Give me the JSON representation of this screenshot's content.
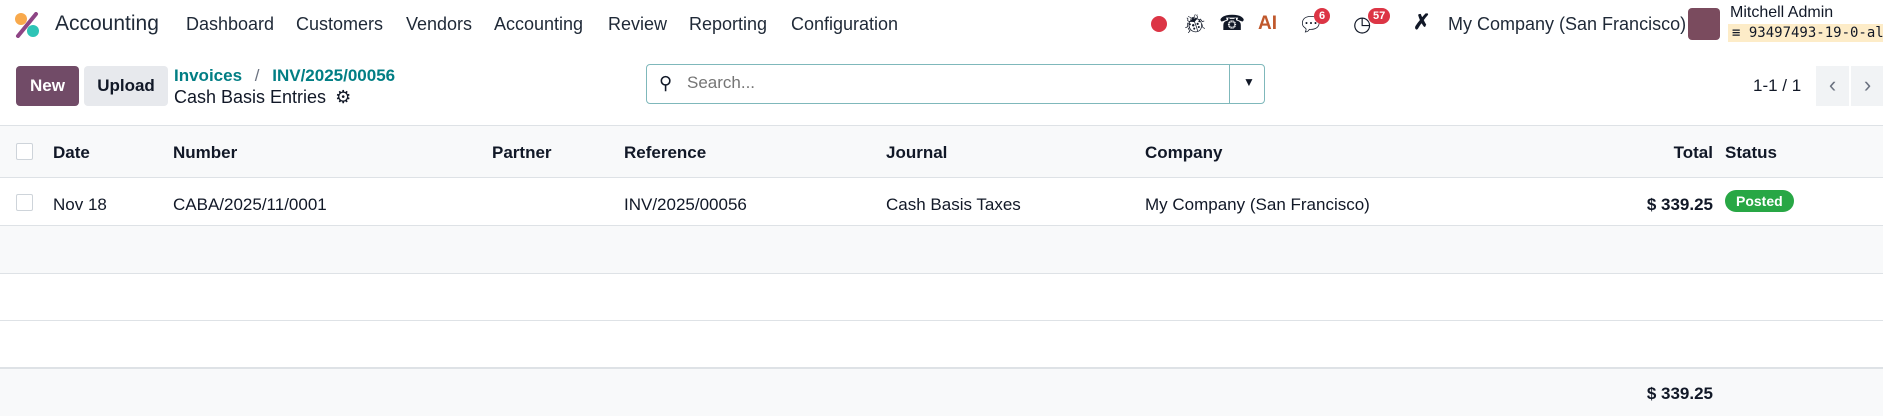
{
  "navbar": {
    "app_name": "Accounting",
    "menu": [
      "Dashboard",
      "Customers",
      "Vendors",
      "Accounting",
      "Review",
      "Reporting",
      "Configuration"
    ],
    "messages_count": "6",
    "activities_count": "57",
    "ai_label": "AI",
    "company": "My Company (San Francisco)",
    "user_name": "Mitchell Admin",
    "database": "93497493-19-0-al"
  },
  "control_panel": {
    "new_label": "New",
    "upload_label": "Upload",
    "breadcrumb": [
      "Invoices",
      "INV/2025/00056"
    ],
    "breadcrumb_sep": "/",
    "title": "Cash Basis Entries",
    "search_placeholder": "Search...",
    "pager": "1-1 / 1"
  },
  "table": {
    "headers": {
      "date": "Date",
      "number": "Number",
      "partner": "Partner",
      "reference": "Reference",
      "journal": "Journal",
      "company": "Company",
      "total": "Total",
      "status": "Status"
    },
    "rows": [
      {
        "date": "Nov 18",
        "number": "CABA/2025/11/0001",
        "partner": "",
        "reference": "INV/2025/00056",
        "journal": "Cash Basis Taxes",
        "company": "My Company (San Francisco)",
        "total": "$ 339.25",
        "status": "Posted"
      }
    ],
    "footer_total": "$ 339.25"
  },
  "colors": {
    "primary": "#714b67",
    "link": "#017e84",
    "posted": "#28a745",
    "badge": "#dc3545"
  }
}
